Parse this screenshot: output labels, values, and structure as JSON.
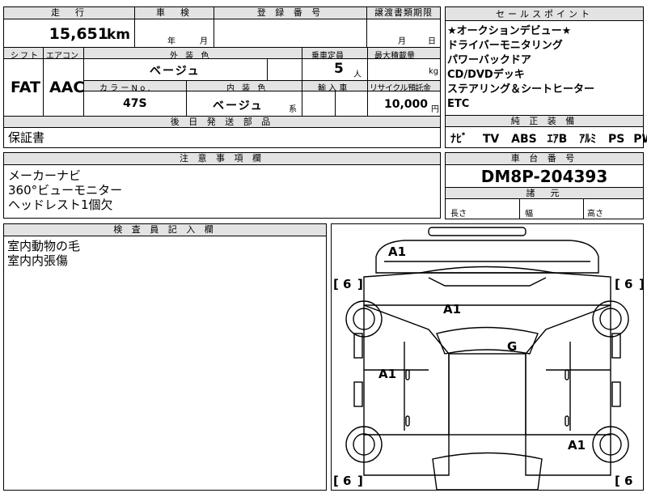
{
  "top_row": {
    "mileage_header": "走　行",
    "shaken_header": "車　検",
    "registration_header": "登 録 番 号",
    "transfer_header": "譲渡書類期限",
    "mileage_value": "15,651",
    "mileage_unit": "km",
    "shaken_year": "年",
    "shaken_month": "月",
    "transfer_month": "月",
    "transfer_day": "日"
  },
  "spec_row": {
    "shift_header": "シフト",
    "aircon_header": "エアコン",
    "exterior_color_header": "外 装 色",
    "capacity_header": "乗車定員",
    "max_load_header": "最大積載量",
    "shift_value": "FAT",
    "aircon_value": "AAC",
    "exterior_color_value": "ベージュ",
    "capacity_value": "5",
    "capacity_unit": "人",
    "max_load_unit": "kg",
    "color_no_header": "カ ラ ー N o .",
    "interior_color_header": "内 装 色",
    "import_header": "輸 入 車",
    "recycle_header": "リサイクル預託金",
    "color_no_value": "47S",
    "interior_color_value": "ベージュ",
    "interior_suffix": "系",
    "recycle_value": "10,000",
    "recycle_unit": "円"
  },
  "shipping": {
    "header": "後 日 発 送 部 品",
    "value": "保証書"
  },
  "sales_points": {
    "header": "セールスポイント",
    "lines": [
      "★オークションデビュー★",
      "ドライバーモニタリング",
      "パワーバックドア",
      "CD/DVDデッキ",
      "ステアリング＆シートヒーター",
      "ETC"
    ]
  },
  "equipment": {
    "header": "純 正 装 備",
    "items": [
      "ﾅﾋﾞ",
      "TV",
      "ABS",
      "ｴｱB",
      "ｱﾙﾐ",
      "PS",
      "PW"
    ]
  },
  "notes": {
    "header": "注 意 事 項 欄",
    "lines": [
      "メーカーナビ",
      "360°ビューモニター",
      "ヘッドレスト1個欠"
    ]
  },
  "chassis": {
    "header": "車 台 番 号",
    "value": "DM8P-204393"
  },
  "dimensions": {
    "header": "諸　元",
    "length_label": "長さ",
    "width_label": "幅",
    "height_label": "高さ"
  },
  "inspector": {
    "header": "検 査 員 記 入 欄",
    "lines": [
      "室内動物の毛",
      "室内内張傷"
    ]
  },
  "diagram": {
    "marks": {
      "front_bumper": "A1",
      "hood": "A1",
      "windshield": "G",
      "left_doors": "A1",
      "right_rear_fender": "A1"
    },
    "tire_open": "[",
    "tire_close": "]",
    "tire_depth": "6"
  }
}
